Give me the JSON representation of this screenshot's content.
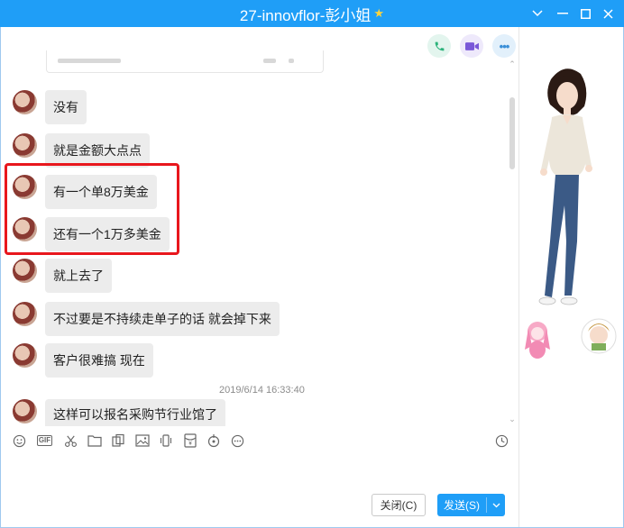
{
  "window": {
    "title": "27-innovflor-彭小姐",
    "title_star_icon": "star-icon",
    "controls": [
      "chevron-down-icon",
      "minimize-icon",
      "maximize-icon",
      "close-icon"
    ]
  },
  "call_actions": {
    "voice": "phone-icon",
    "video": "video-icon",
    "more": "more-icon"
  },
  "messages": [
    {
      "text": "没有"
    },
    {
      "text": "就是金额大点点"
    },
    {
      "text": "有一个单8万美金"
    },
    {
      "text": "还有一个1万多美金"
    },
    {
      "text": "就上去了"
    },
    {
      "text": "不过要是不持续走单子的话 就会掉下来"
    },
    {
      "text": "客户很难搞 现在"
    },
    {
      "text": "这样可以报名采购节行业馆了"
    }
  ],
  "timestamp": "2019/6/14 16:33:40",
  "input_toolbar": {
    "tools": [
      "emoji-icon",
      "gif-icon",
      "scissors-icon",
      "folder-icon",
      "screenshot-icon",
      "image-icon",
      "shake-icon",
      "red-packet-icon",
      "transfer-icon",
      "more-circle-icon"
    ],
    "gif_label": "GIF",
    "history": "clock-icon"
  },
  "buttons": {
    "close": "关闭(C)",
    "send": "发送(S)"
  },
  "colors": {
    "title_bar": "#1f9ef7",
    "bubble": "#ececec",
    "highlight": "#e8171d",
    "send_button": "#1f9ef7"
  }
}
